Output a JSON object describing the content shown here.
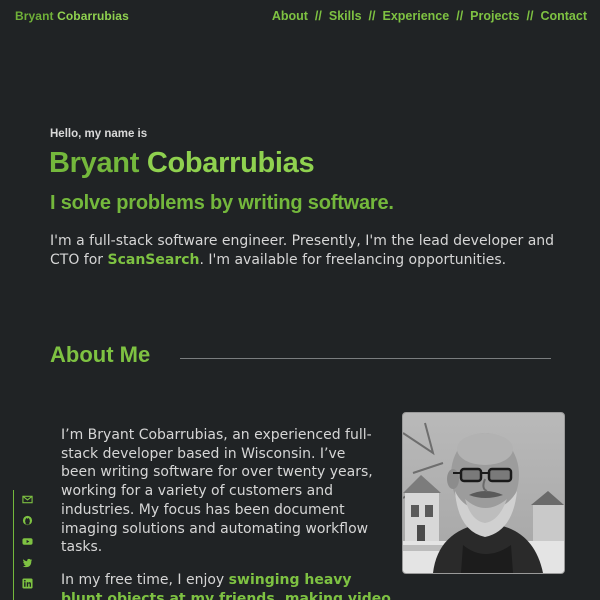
{
  "header": {
    "logo_first": "Bryant",
    "logo_last": "Cobarrubias",
    "nav": [
      "About",
      "Skills",
      "Experience",
      "Projects",
      "Contact"
    ],
    "separator": "//"
  },
  "hero": {
    "intro": "Hello, my name is",
    "first_name": "Bryant",
    "last_name": "Cobarrubias",
    "tagline": "I solve problems by writing software.",
    "desc_before": "I'm a full-stack software engineer. Presently, I'm the lead developer and CTO for ",
    "desc_link": "ScanSearch",
    "desc_after": ". I'm available for freelancing opportunities."
  },
  "about": {
    "heading": "About Me",
    "p1": "I’m Bryant Cobarrubias, an experienced full-stack developer based in Wisconsin. I’ve been writing software for over twenty years, working for a variety of customers and industries. My focus has been document imaging solutions and automating workflow tasks.",
    "p2_before": "In my free time, I enjoy ",
    "p2_link": "swinging heavy blunt objects at my friends, making video"
  },
  "social": {
    "icons": [
      "mail-icon",
      "github-icon",
      "youtube-icon",
      "twitter-icon",
      "linkedin-icon"
    ]
  },
  "colors": {
    "background": "#202325",
    "accent": "#7ec242",
    "text": "#d6d6d6"
  }
}
